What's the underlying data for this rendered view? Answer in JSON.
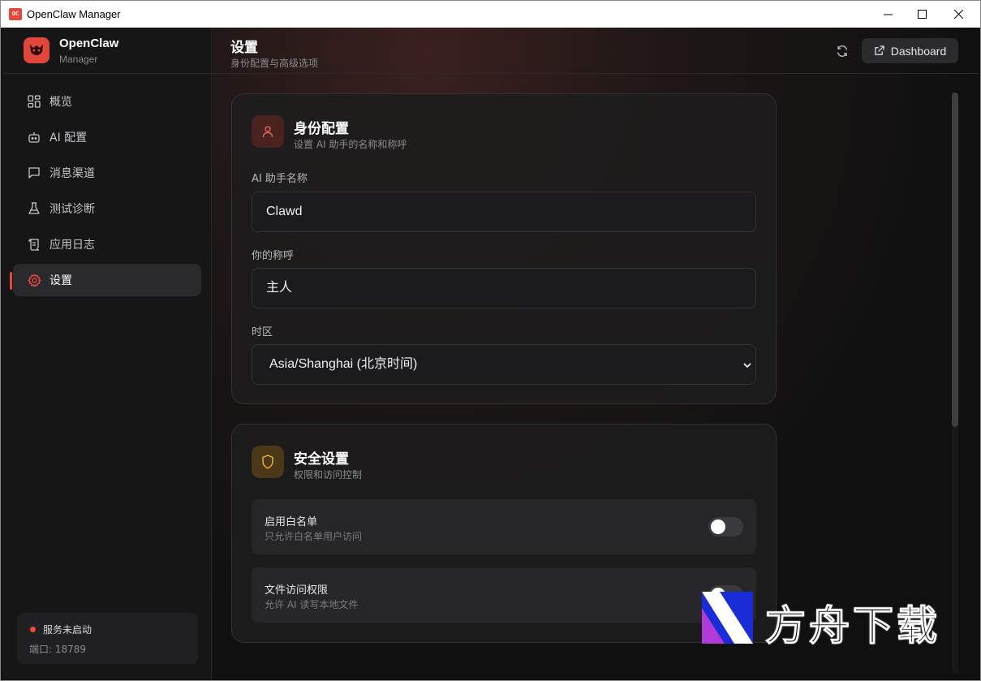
{
  "window": {
    "title": "OpenClaw Manager",
    "app_icon_text": "OC"
  },
  "brand": {
    "name": "OpenClaw",
    "subtitle": "Manager"
  },
  "nav": [
    {
      "label": "概览",
      "icon": "grid-icon"
    },
    {
      "label": "AI 配置",
      "icon": "robot-icon"
    },
    {
      "label": "消息渠道",
      "icon": "message-icon"
    },
    {
      "label": "测试诊断",
      "icon": "flask-icon"
    },
    {
      "label": "应用日志",
      "icon": "scroll-icon"
    },
    {
      "label": "设置",
      "icon": "gear-icon",
      "active": true
    }
  ],
  "status": {
    "text": "服务未启动",
    "port": "端口: 18789",
    "color": "#ee4a3f"
  },
  "header": {
    "title": "设置",
    "subtitle": "身份配置与高级选项",
    "dashboard_label": "Dashboard"
  },
  "identity": {
    "title": "身份配置",
    "subtitle": "设置 AI 助手的名称和称呼",
    "name_label": "AI 助手名称",
    "name_value": "Clawd",
    "call_label": "你的称呼",
    "call_value": "主人",
    "tz_label": "时区",
    "tz_value": "Asia/Shanghai (北京时间)"
  },
  "security": {
    "title": "安全设置",
    "subtitle": "权限和访问控制",
    "rows": [
      {
        "title": "启用白名单",
        "desc": "只允许白名单用户访问",
        "enabled": false
      },
      {
        "title": "文件访问权限",
        "desc": "允许 AI 读写本地文件",
        "enabled": false
      }
    ]
  },
  "watermark": {
    "text": "方舟下载"
  },
  "colors": {
    "accent": "#e5483a",
    "warning": "#e0a83a",
    "background": "#131314"
  }
}
